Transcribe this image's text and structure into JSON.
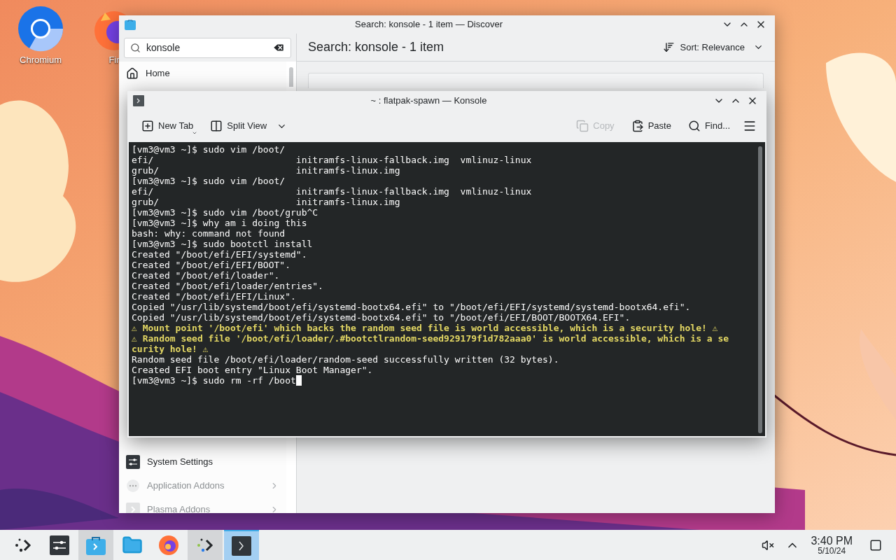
{
  "desktop": {
    "icons": [
      {
        "label": "Chromium",
        "kind": "chromium"
      },
      {
        "label": "Fir",
        "kind": "firefox"
      }
    ]
  },
  "discover": {
    "title": "Search: konsole - 1 item — Discover",
    "search": {
      "value": "konsole"
    },
    "heading": "Search: konsole - 1 item",
    "sort": "Sort: Relevance",
    "sidebar": {
      "items": [
        {
          "label": "Home",
          "kind": "home",
          "disabled": false,
          "has_children": false
        },
        {
          "label": "System Settings",
          "kind": "settings",
          "disabled": false,
          "has_children": false
        },
        {
          "label": "Application Addons",
          "kind": "addons",
          "disabled": true,
          "has_children": true
        },
        {
          "label": "Plasma Addons",
          "kind": "plasma",
          "disabled": true,
          "has_children": true
        }
      ]
    }
  },
  "konsole": {
    "title": "~ : flatpak-spawn — Konsole",
    "toolbar": [
      {
        "label": "New Tab",
        "kind": "new-tab",
        "disabled": false
      },
      {
        "label": "Split View",
        "kind": "split-view",
        "disabled": false
      },
      {
        "label": "Copy",
        "kind": "copy",
        "disabled": true
      },
      {
        "label": "Paste",
        "kind": "paste",
        "disabled": false
      },
      {
        "label": "Find...",
        "kind": "find",
        "disabled": false
      }
    ],
    "terminal": {
      "cursor": true,
      "lines": [
        {
          "text": "[vm3@vm3 ~]$ sudo vim /boot/",
          "kind": "normal"
        },
        {
          "text": "efi/                          initramfs-linux-fallback.img  vmlinuz-linux",
          "kind": "normal"
        },
        {
          "text": "grub/                         initramfs-linux.img",
          "kind": "normal"
        },
        {
          "text": "[vm3@vm3 ~]$ sudo vim /boot/",
          "kind": "normal"
        },
        {
          "text": "efi/                          initramfs-linux-fallback.img  vmlinuz-linux",
          "kind": "normal"
        },
        {
          "text": "grub/                         initramfs-linux.img",
          "kind": "normal"
        },
        {
          "text": "[vm3@vm3 ~]$ sudo vim /boot/grub^C",
          "kind": "normal"
        },
        {
          "text": "[vm3@vm3 ~]$ why am i doing this",
          "kind": "normal"
        },
        {
          "text": "bash: why: command not found",
          "kind": "normal"
        },
        {
          "text": "[vm3@vm3 ~]$ sudo bootctl install",
          "kind": "normal"
        },
        {
          "text": "Created \"/boot/efi/EFI/systemd\".",
          "kind": "normal"
        },
        {
          "text": "Created \"/boot/efi/EFI/BOOT\".",
          "kind": "normal"
        },
        {
          "text": "Created \"/boot/efi/loader\".",
          "kind": "normal"
        },
        {
          "text": "Created \"/boot/efi/loader/entries\".",
          "kind": "normal"
        },
        {
          "text": "Created \"/boot/efi/EFI/Linux\".",
          "kind": "normal"
        },
        {
          "text": "Copied \"/usr/lib/systemd/boot/efi/systemd-bootx64.efi\" to \"/boot/efi/EFI/systemd/systemd-bootx64.efi\".",
          "kind": "normal"
        },
        {
          "text": "Copied \"/usr/lib/systemd/boot/efi/systemd-bootx64.efi\" to \"/boot/efi/EFI/BOOT/BOOTX64.EFI\".",
          "kind": "normal"
        },
        {
          "text": "⚠ Mount point '/boot/efi' which backs the random seed file is world accessible, which is a security hole! ⚠",
          "kind": "warning"
        },
        {
          "text": "⚠ Random seed file '/boot/efi/loader/.#bootctlrandom-seed929179f1d782aaa0' is world accessible, which is a se",
          "kind": "warning"
        },
        {
          "text": "curity hole! ⚠",
          "kind": "warning"
        },
        {
          "text": "Random seed file /boot/efi/loader/random-seed successfully written (32 bytes).",
          "kind": "normal"
        },
        {
          "text": "Created EFI boot entry \"Linux Boot Manager\".",
          "kind": "normal"
        },
        {
          "text": "[vm3@vm3 ~]$ sudo rm -rf /boot",
          "kind": "normal"
        }
      ]
    }
  },
  "taskbar": {
    "tasks": [
      {
        "kind": "launcher",
        "open": false,
        "active": false
      },
      {
        "kind": "settings",
        "open": false,
        "active": false
      },
      {
        "kind": "discover",
        "open": true,
        "active": false
      },
      {
        "kind": "files",
        "open": false,
        "active": false
      },
      {
        "kind": "firefox",
        "open": false,
        "active": false
      },
      {
        "kind": "connect",
        "open": true,
        "active": false
      },
      {
        "kind": "konsole",
        "open": true,
        "active": true
      }
    ],
    "tray": {
      "muted": true
    },
    "clock": {
      "time": "3:40 PM",
      "date": "5/10/24"
    }
  }
}
